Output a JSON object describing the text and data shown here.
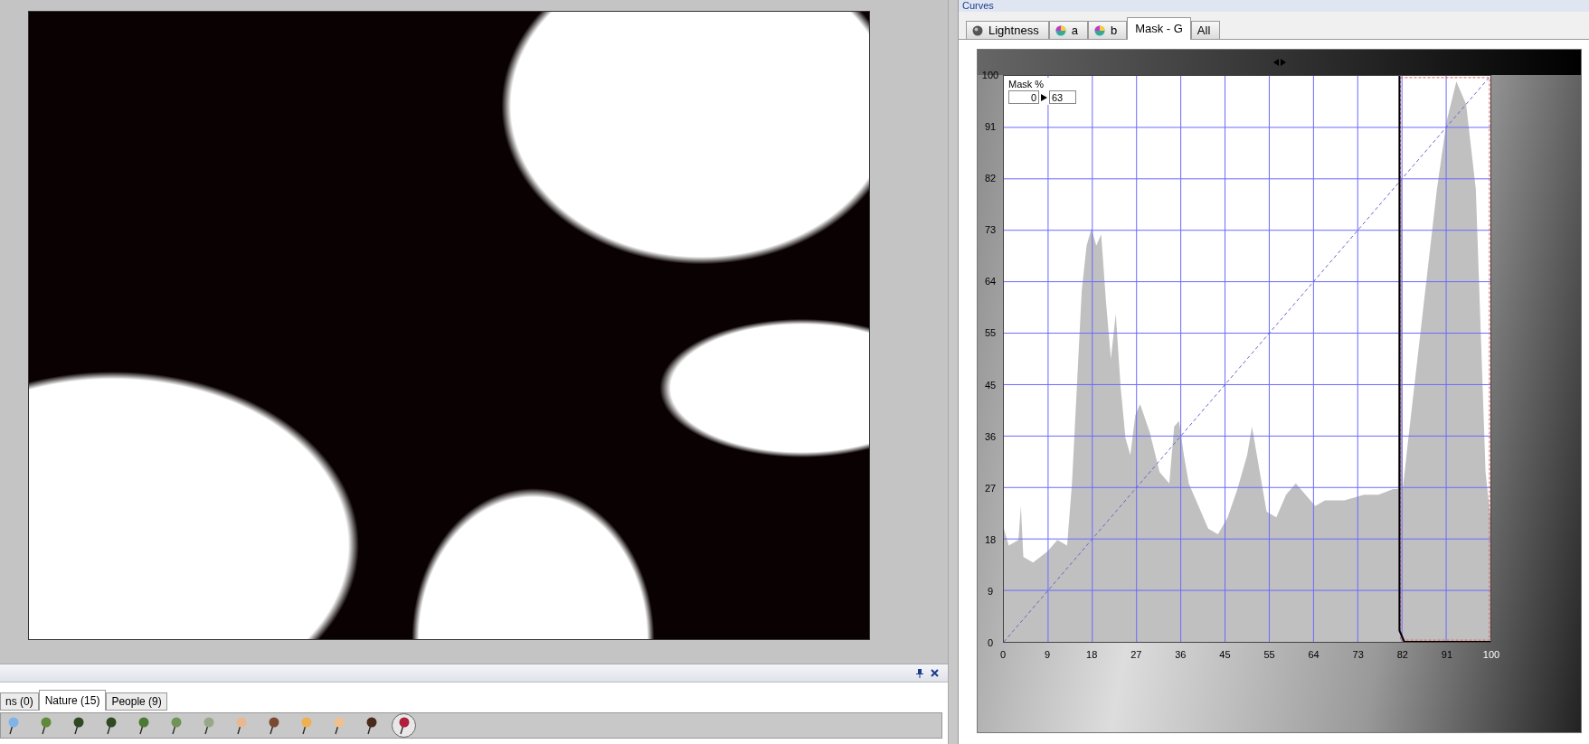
{
  "bottom_panel": {
    "tabs": [
      {
        "label": "ns (0)",
        "selected": false
      },
      {
        "label": "Nature (15)",
        "selected": true
      },
      {
        "label": "People (9)",
        "selected": false
      }
    ],
    "pins": [
      {
        "color": "#7fb4e8",
        "selected": false
      },
      {
        "color": "#5e8a3a",
        "selected": false
      },
      {
        "color": "#2f4a22",
        "selected": false
      },
      {
        "color": "#2f4a22",
        "selected": false
      },
      {
        "color": "#4d7a33",
        "selected": false
      },
      {
        "color": "#6f9455",
        "selected": false
      },
      {
        "color": "#97a888",
        "selected": false
      },
      {
        "color": "#e8b890",
        "selected": false
      },
      {
        "color": "#7a4a30",
        "selected": false
      },
      {
        "color": "#f0b050",
        "selected": false
      },
      {
        "color": "#f0c090",
        "selected": false
      },
      {
        "color": "#4a2a1a",
        "selected": false
      },
      {
        "color": "#b0203a",
        "selected": true
      }
    ]
  },
  "curves": {
    "title": "Curves",
    "tabs": [
      {
        "label": "Lightness",
        "selected": false,
        "kind": "grey"
      },
      {
        "label": "a",
        "selected": false,
        "kind": "color"
      },
      {
        "label": "b",
        "selected": false,
        "kind": "color"
      },
      {
        "label": "Mask - G",
        "selected": true,
        "kind": "none"
      },
      {
        "label": "All",
        "selected": false,
        "kind": "none"
      }
    ],
    "mask": {
      "label": "Mask %",
      "from": "0",
      "to": "63"
    },
    "y_axis_labels": [
      "100",
      "91",
      "82",
      "73",
      "64",
      "55",
      "45",
      "36",
      "27",
      "18",
      "9",
      "0"
    ],
    "x_axis_labels": [
      "0",
      "9",
      "18",
      "27",
      "36",
      "45",
      "55",
      "64",
      "73",
      "82",
      "91",
      "100"
    ]
  }
}
